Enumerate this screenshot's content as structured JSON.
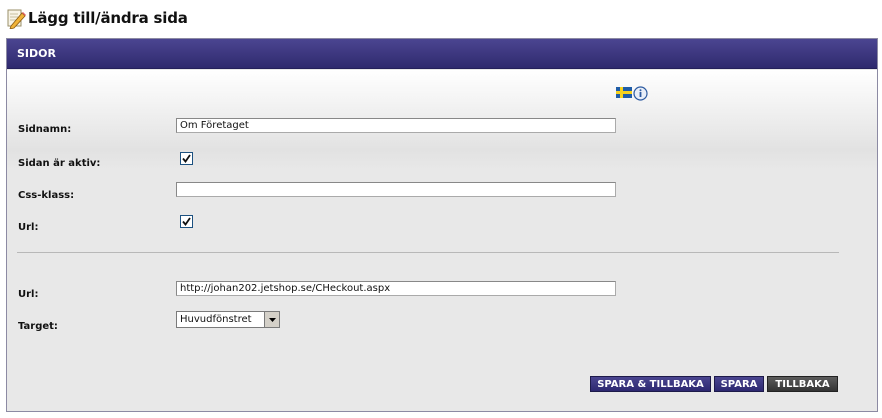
{
  "page": {
    "title": "Lägg till/ändra sida"
  },
  "panel": {
    "title": "SIDOR"
  },
  "form": {
    "page_name": {
      "label": "Sidnamn:",
      "value": "Om Företaget",
      "language_flag": "swedish-flag-icon",
      "info_icon": "info-icon"
    },
    "active": {
      "label": "Sidan är aktiv:",
      "checked": true
    },
    "css_class": {
      "label": "Css-klass:",
      "value": ""
    },
    "url_enabled": {
      "label": "Url:",
      "checked": true
    },
    "url": {
      "label": "Url:",
      "value": "http://johan202.jetshop.se/CHeckout.aspx"
    },
    "target": {
      "label": "Target:",
      "selected": "Huvudfönstret"
    }
  },
  "buttons": {
    "save_and_back": "SPARA & TILLBAKA",
    "save": "SPARA",
    "back": "TILLBAKA"
  },
  "colors": {
    "panel_header": "#3a3580",
    "panel_body": "#e8e8e8",
    "back_button": "#444444"
  }
}
